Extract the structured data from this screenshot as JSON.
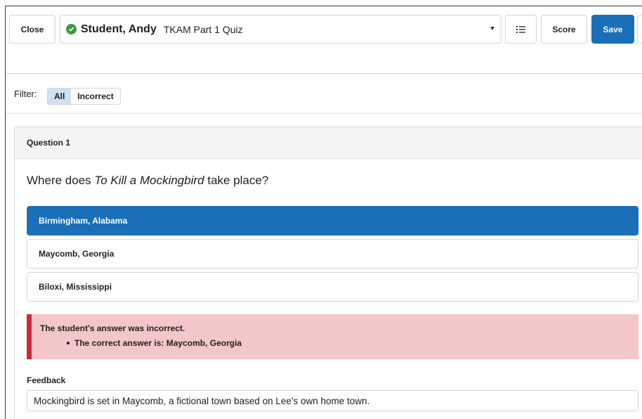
{
  "toolbar": {
    "close_label": "Close",
    "student_name": "Student, Andy",
    "quiz_name": "TKAM Part 1 Quiz",
    "score_label": "Score",
    "save_label": "Save"
  },
  "filter": {
    "label": "Filter:",
    "options": [
      "All",
      "Incorrect"
    ],
    "active": "All"
  },
  "question": {
    "header": "Question 1",
    "prompt_before": "Where does ",
    "prompt_title": "To Kill a Mockingbird",
    "prompt_after": " take place?",
    "options": [
      {
        "label": "Birmingham, Alabama",
        "selected": true
      },
      {
        "label": "Maycomb, Georgia",
        "selected": false
      },
      {
        "label": "Biloxi, Mississippi",
        "selected": false
      }
    ]
  },
  "result": {
    "message": "The student's answer was incorrect.",
    "correct_answer": "The correct answer is: Maycomb, Georgia"
  },
  "feedback": {
    "label": "Feedback",
    "value": "Mockingbird is set in Maycomb, a fictional town based on Lee's own home town."
  },
  "colors": {
    "primary": "#1a6fb8",
    "success": "#3c9a3c",
    "error_bg": "#f3c6c9",
    "error_border": "#d0283a",
    "filter_active": "#cfe1f3"
  },
  "icons": {
    "status": "check-circle-icon",
    "dropdown": "chevron-down-icon",
    "list": "list-icon"
  }
}
